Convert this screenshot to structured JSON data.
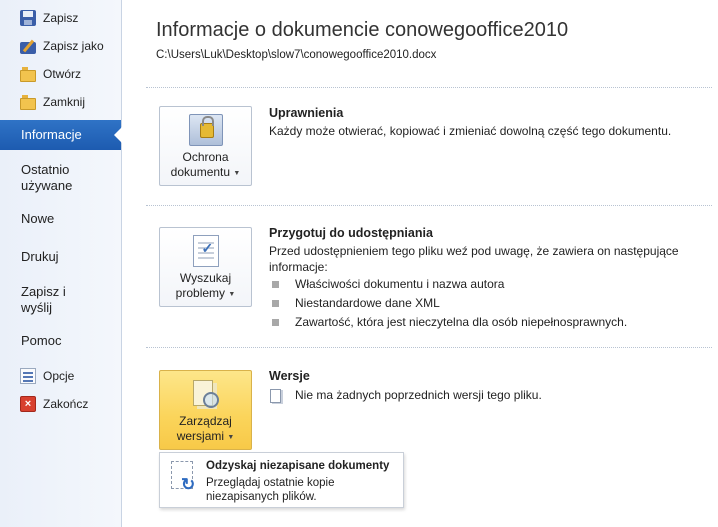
{
  "sidebar": {
    "commands_top": [
      {
        "label": "Zapisz",
        "icon": "save-icon"
      },
      {
        "label": "Zapisz jako",
        "icon": "save-as-icon"
      },
      {
        "label": "Otwórz",
        "icon": "open-folder-icon"
      },
      {
        "label": "Zamknij",
        "icon": "close-folder-icon"
      }
    ],
    "tabs": [
      {
        "label": "Informacje",
        "active": true
      },
      {
        "label_line1": "Ostatnio",
        "label_line2": "używane"
      },
      {
        "label": "Nowe"
      },
      {
        "label": "Drukuj"
      },
      {
        "label_line1": "Zapisz i",
        "label_line2": "wyślij"
      },
      {
        "label": "Pomoc"
      }
    ],
    "commands_bottom": [
      {
        "label": "Opcje",
        "icon": "options-icon"
      },
      {
        "label": "Zakończ",
        "icon": "exit-icon"
      }
    ],
    "active_color": "#2a6bc2"
  },
  "header": {
    "title": "Informacje o dokumencie conowegooffice2010",
    "path": "C:\\Users\\Luk\\Desktop\\slow7\\conowegooffice2010.docx"
  },
  "sections": {
    "permissions": {
      "button_line1": "Ochrona",
      "button_line2": "dokumentu",
      "heading": "Uprawnienia",
      "text": "Każdy może otwierać, kopiować i zmieniać dowolną część tego dokumentu."
    },
    "prepare": {
      "button_line1": "Wyszukaj",
      "button_line2": "problemy",
      "heading": "Przygotuj do udostępniania",
      "text_line1": "Przed udostępnieniem tego pliku weź pod uwagę, że zawiera on następujące",
      "text_line2": "informacje:",
      "bullets": [
        "Właściwości dokumentu i nazwa autora",
        "Niestandardowe dane XML",
        "Zawartość, która jest nieczytelna dla osób niepełnosprawnych."
      ]
    },
    "versions": {
      "button_line1": "Zarządzaj",
      "button_line2": "wersjami",
      "heading": "Wersje",
      "text": "Nie ma żadnych poprzednich wersji tego pliku."
    }
  },
  "dropdown": {
    "title": "Odzyskaj niezapisane dokumenty",
    "desc_line1": "Przeglądaj ostatnie kopie",
    "desc_line2": "niezapisanych plików."
  },
  "arrow_glyph": "▼"
}
